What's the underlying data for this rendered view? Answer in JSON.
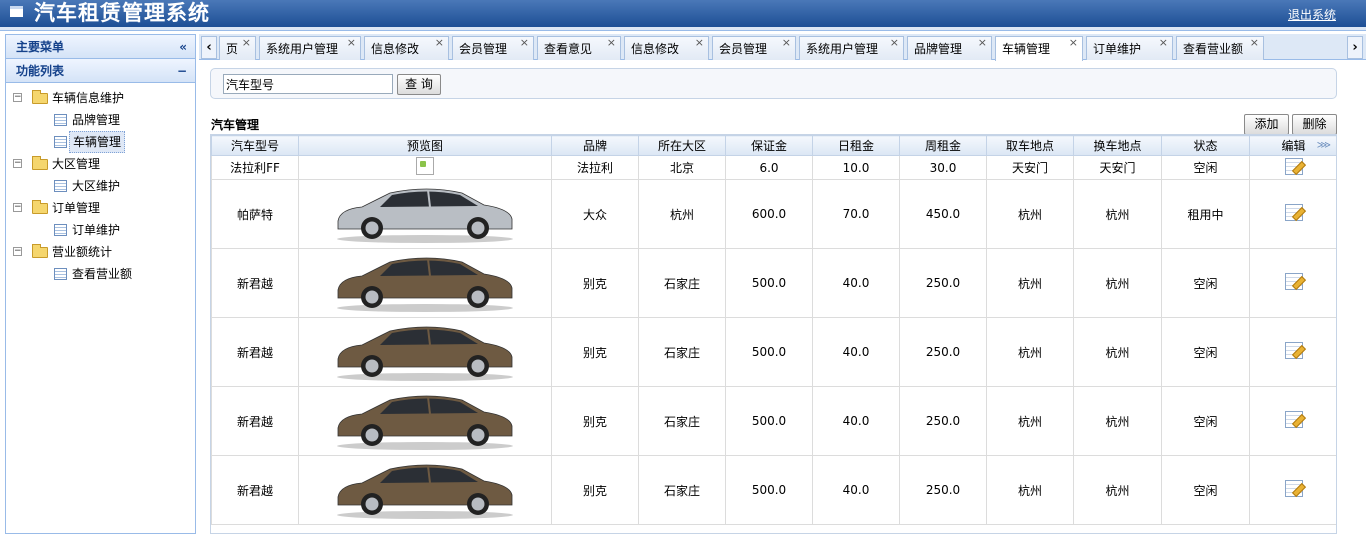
{
  "header": {
    "title": "汽车租赁管理系统",
    "logout": "退出系统"
  },
  "sidebar": {
    "main_title": "主要菜单",
    "collapse_icon": "«",
    "func_title": "功能列表",
    "func_toggle": "−",
    "groups": [
      {
        "label": "车辆信息维护",
        "items": [
          "品牌管理",
          "车辆管理"
        ]
      },
      {
        "label": "大区管理",
        "items": [
          "大区维护"
        ]
      },
      {
        "label": "订单管理",
        "items": [
          "订单维护"
        ]
      },
      {
        "label": "营业额统计",
        "items": [
          "查看营业额"
        ]
      }
    ],
    "selected": "车辆管理"
  },
  "tabs": {
    "items": [
      "页",
      "系统用户管理",
      "信息修改",
      "会员管理",
      "查看意见",
      "信息修改",
      "会员管理",
      "系统用户管理",
      "品牌管理",
      "车辆管理",
      "订单维护",
      "查看营业额"
    ],
    "active": "车辆管理",
    "prev_icon": "‹",
    "next_icon": "›"
  },
  "search": {
    "placeholder": "汽车型号",
    "value": "汽车型号",
    "button": "查 询"
  },
  "grid": {
    "title": "汽车管理",
    "add_button": "添加",
    "delete_button": "删除",
    "more_icon": "⋙",
    "columns": [
      "汽车型号",
      "预览图",
      "品牌",
      "所在大区",
      "保证金",
      "日租金",
      "周租金",
      "取车地点",
      "换车地点",
      "状态",
      "编辑"
    ],
    "rows": [
      {
        "model": "法拉利FF",
        "image": "broken-image-icon",
        "brand": "法拉利",
        "region": "北京",
        "deposit": "6.0",
        "daily": "10.0",
        "weekly": "30.0",
        "pickup": "天安门",
        "return": "天安门",
        "status": "空闲"
      },
      {
        "model": "帕萨特",
        "image": "silver-sedan",
        "brand": "大众",
        "region": "杭州",
        "deposit": "600.0",
        "daily": "70.0",
        "weekly": "450.0",
        "pickup": "杭州",
        "return": "杭州",
        "status": "租用中"
      },
      {
        "model": "新君越",
        "image": "bronze-sedan",
        "brand": "别克",
        "region": "石家庄",
        "deposit": "500.0",
        "daily": "40.0",
        "weekly": "250.0",
        "pickup": "杭州",
        "return": "杭州",
        "status": "空闲"
      },
      {
        "model": "新君越",
        "image": "bronze-sedan",
        "brand": "别克",
        "region": "石家庄",
        "deposit": "500.0",
        "daily": "40.0",
        "weekly": "250.0",
        "pickup": "杭州",
        "return": "杭州",
        "status": "空闲"
      },
      {
        "model": "新君越",
        "image": "bronze-sedan",
        "brand": "别克",
        "region": "石家庄",
        "deposit": "500.0",
        "daily": "40.0",
        "weekly": "250.0",
        "pickup": "杭州",
        "return": "杭州",
        "status": "空闲"
      },
      {
        "model": "新君越",
        "image": "bronze-sedan",
        "brand": "别克",
        "region": "石家庄",
        "deposit": "500.0",
        "daily": "40.0",
        "weekly": "250.0",
        "pickup": "杭州",
        "return": "杭州",
        "status": "空闲"
      }
    ],
    "colors": {
      "silver_car": "#b9bec4",
      "bronze_car": "#6e5a42"
    }
  }
}
